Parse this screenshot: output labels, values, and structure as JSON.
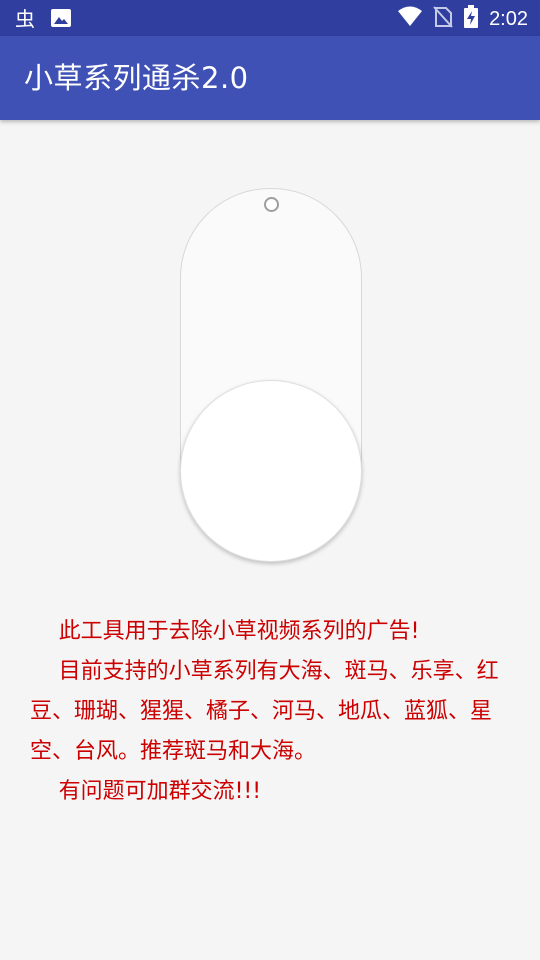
{
  "status_bar": {
    "time": "2:02",
    "icons": [
      "debug-bug-icon",
      "image-icon",
      "wifi-icon",
      "no-sim-icon",
      "battery-charging-icon"
    ]
  },
  "app_bar": {
    "title": "小草系列通杀2.0",
    "background": "#3f51b5",
    "status_background": "#303f9f"
  },
  "switch": {
    "state": "off"
  },
  "description": {
    "color": "#cc0000",
    "paragraphs": [
      "此工具用于去除小草视频系列的广告!",
      "目前支持的小草系列有大海、斑马、乐享、红豆、珊瑚、猩猩、橘子、河马、地瓜、蓝狐、星空、台风。推荐斑马和大海。",
      "有问题可加群交流!!!"
    ]
  }
}
